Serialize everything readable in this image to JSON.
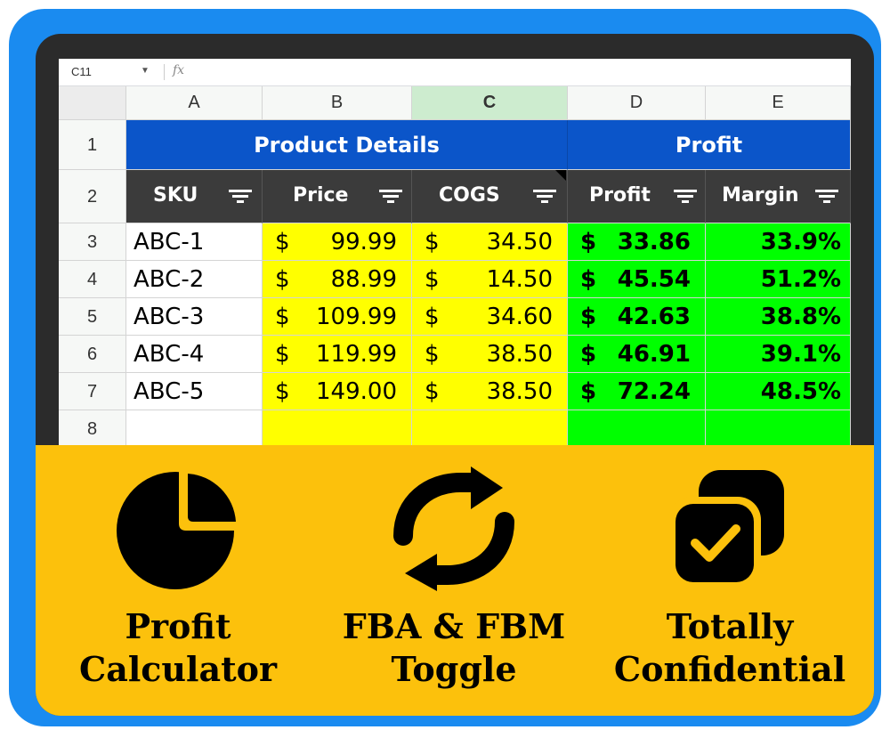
{
  "formula_bar": {
    "name_box": "C11",
    "fx_label": "fx"
  },
  "columns": [
    "A",
    "B",
    "C",
    "D",
    "E"
  ],
  "selected_column": "C",
  "rows": [
    "1",
    "2",
    "3",
    "4",
    "5",
    "6",
    "7",
    "8"
  ],
  "groups": {
    "product_details": "Product Details",
    "profit": "Profit"
  },
  "headers": [
    "SKU",
    "Price",
    "COGS",
    "Profit",
    "Margin"
  ],
  "currency_symbol": "$",
  "table": [
    {
      "sku": "ABC-1",
      "price": "99.99",
      "cogs": "34.50",
      "profit": "33.86",
      "margin": "33.9%"
    },
    {
      "sku": "ABC-2",
      "price": "88.99",
      "cogs": "14.50",
      "profit": "45.54",
      "margin": "51.2%"
    },
    {
      "sku": "ABC-3",
      "price": "109.99",
      "cogs": "34.60",
      "profit": "42.63",
      "margin": "38.8%"
    },
    {
      "sku": "ABC-4",
      "price": "119.99",
      "cogs": "38.50",
      "profit": "46.91",
      "margin": "39.1%"
    },
    {
      "sku": "ABC-5",
      "price": "149.00",
      "cogs": "38.50",
      "profit": "72.24",
      "margin": "48.5%"
    }
  ],
  "features": [
    {
      "line1": "Profit",
      "line2": "Calculator",
      "icon": "pie-chart-icon"
    },
    {
      "line1": "FBA & FBM",
      "line2": "Toggle",
      "icon": "refresh-arrows-icon"
    },
    {
      "line1": "Totally",
      "line2": "Confidential",
      "icon": "copy-check-icon"
    }
  ],
  "colors": {
    "frame": "#1a8bf0",
    "group_header": "#0b55c9",
    "input_fill": "#ffff00",
    "output_fill": "#00ff00",
    "panel": "#fcc10c"
  }
}
